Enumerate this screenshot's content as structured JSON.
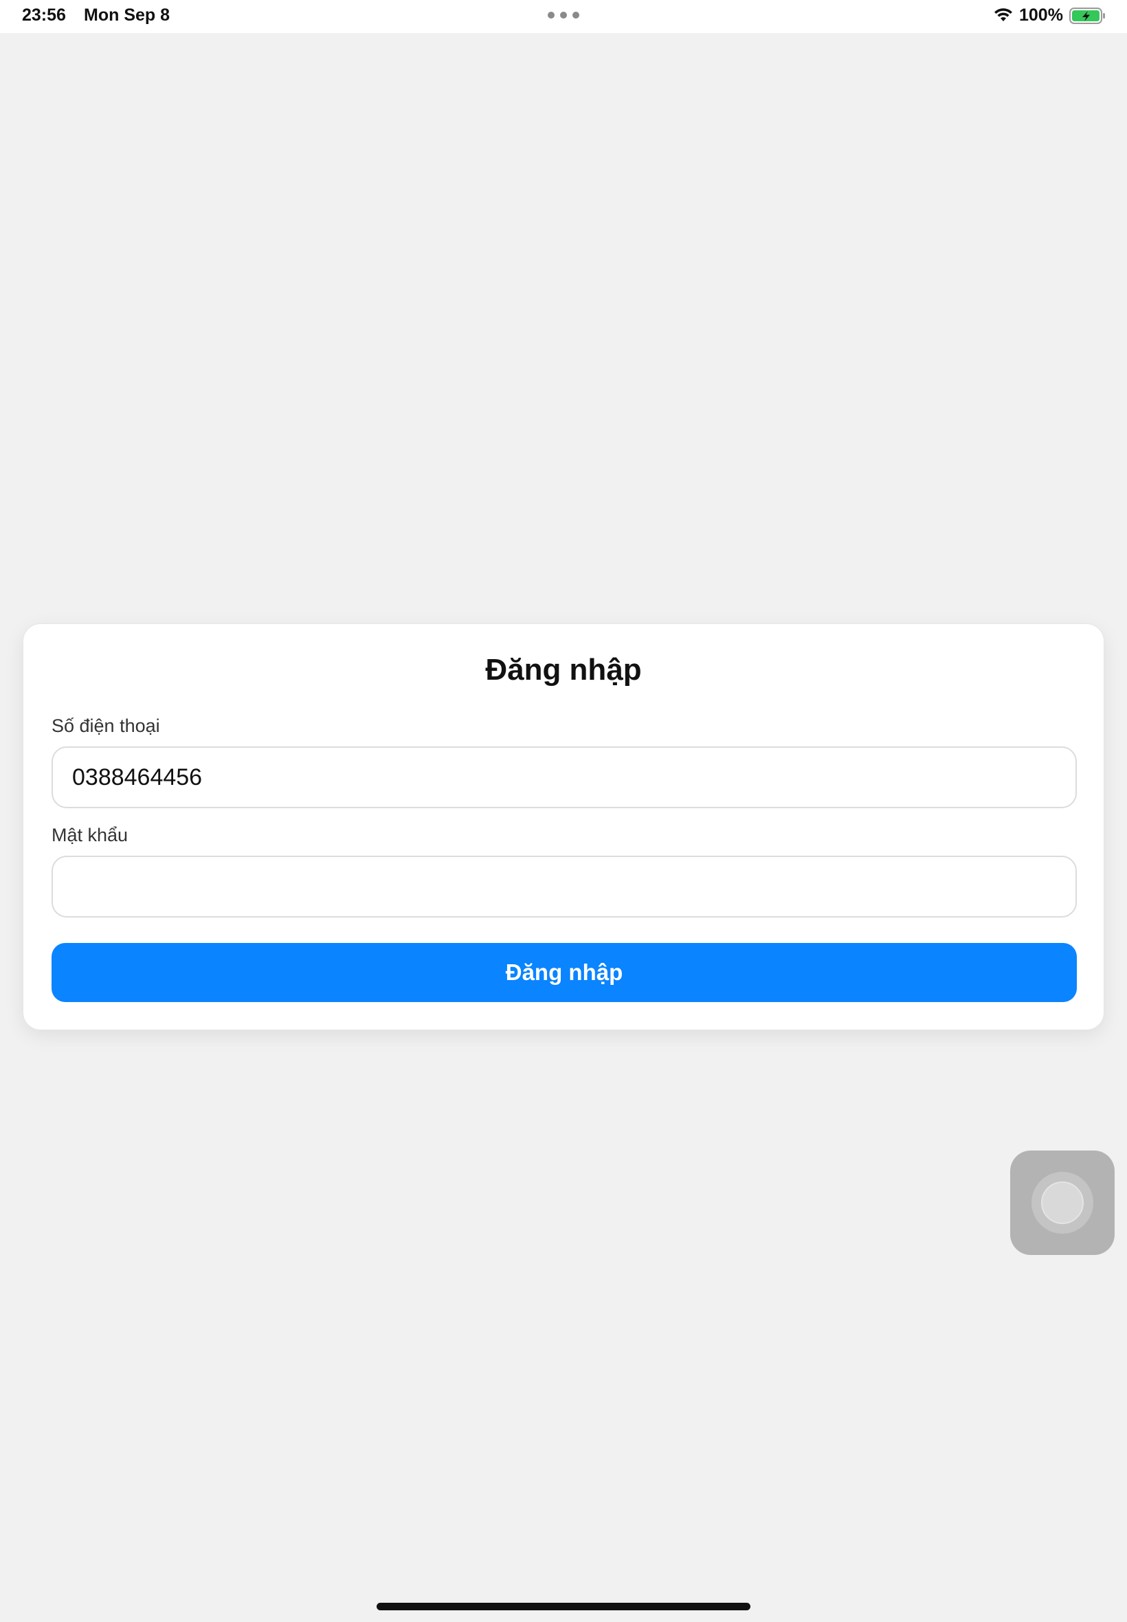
{
  "status_bar": {
    "time": "23:56",
    "date": "Mon Sep 8",
    "battery_percent": "100%",
    "icons": [
      "wifi-icon",
      "battery-charging-icon",
      "multitasking-dots-icon"
    ]
  },
  "login_card": {
    "title": "Đăng nhập",
    "phone": {
      "label": "Số điện thoại",
      "value": "0388464456"
    },
    "password": {
      "label": "Mật khẩu",
      "value": ""
    },
    "submit_label": "Đăng nhập"
  },
  "colors": {
    "background": "#f1f1f1",
    "accent": "#0a84ff",
    "card": "#ffffff",
    "battery_green": "#34c759"
  }
}
